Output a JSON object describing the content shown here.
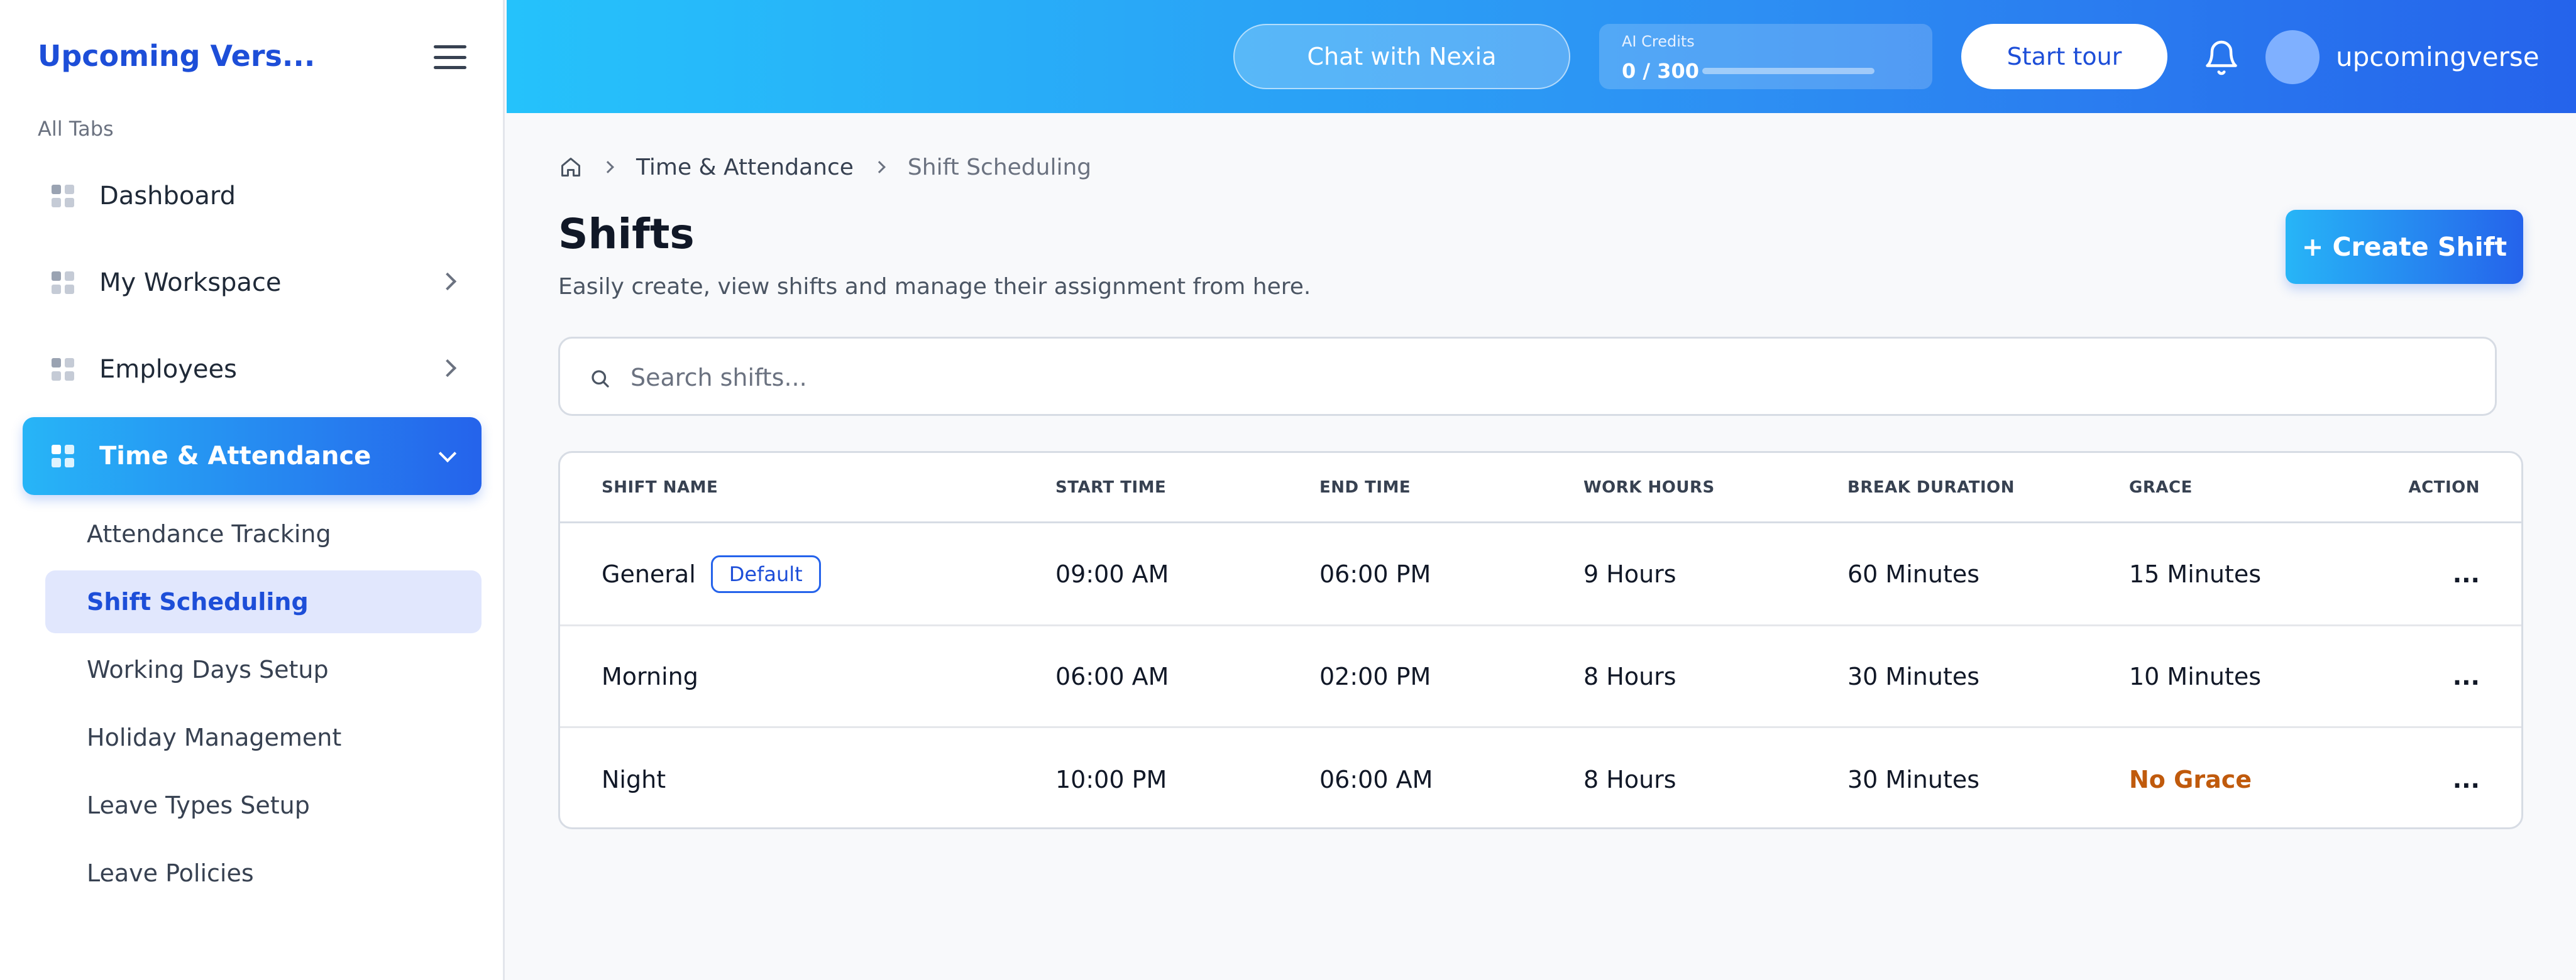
{
  "sidebar": {
    "brand": "Upcoming Vers...",
    "section_label": "All Tabs",
    "items": [
      {
        "label": "Dashboard",
        "expandable": false
      },
      {
        "label": "My Workspace",
        "expandable": true
      },
      {
        "label": "Employees",
        "expandable": true
      },
      {
        "label": "Time & Attendance",
        "expandable": true,
        "active": true
      }
    ],
    "sub_items": [
      {
        "label": "Attendance Tracking"
      },
      {
        "label": "Shift Scheduling",
        "active": true
      },
      {
        "label": "Working Days Setup"
      },
      {
        "label": "Holiday Management"
      },
      {
        "label": "Leave Types Setup"
      },
      {
        "label": "Leave Policies"
      }
    ]
  },
  "header": {
    "chat_label": "Chat with Nexia",
    "credits_label": "AI Credits",
    "credits_value": "0 / 300",
    "credits_used_fraction": 0,
    "tour_label": "Start tour",
    "username": "upcomingverse"
  },
  "breadcrumb": {
    "items": [
      "Time & Attendance",
      "Shift Scheduling"
    ]
  },
  "page": {
    "title": "Shifts",
    "subtitle": "Easily create, view shifts and manage their assignment from here.",
    "create_label": "+ Create Shift"
  },
  "search": {
    "placeholder": "Search shifts..."
  },
  "table": {
    "columns": [
      "SHIFT NAME",
      "START TIME",
      "END TIME",
      "WORK HOURS",
      "BREAK DURATION",
      "GRACE",
      "ACTION"
    ],
    "rows": [
      {
        "name": "General",
        "badge": "Default",
        "start": "09:00 AM",
        "end": "06:00 PM",
        "hours": "9 Hours",
        "break": "60 Minutes",
        "grace": "15 Minutes",
        "action": "..."
      },
      {
        "name": "Morning",
        "start": "06:00 AM",
        "end": "02:00 PM",
        "hours": "8 Hours",
        "break": "30 Minutes",
        "grace": "10 Minutes",
        "action": "..."
      },
      {
        "name": "Night",
        "start": "10:00 PM",
        "end": "06:00 AM",
        "hours": "8 Hours",
        "break": "30 Minutes",
        "grace": "No Grace",
        "action": "..."
      }
    ]
  },
  "colors": {
    "accent": "#2563eb",
    "header_gradient_start": "#25c2fb",
    "active_sub_bg": "#e1e7fd",
    "no_grace": "#c05a0c"
  }
}
